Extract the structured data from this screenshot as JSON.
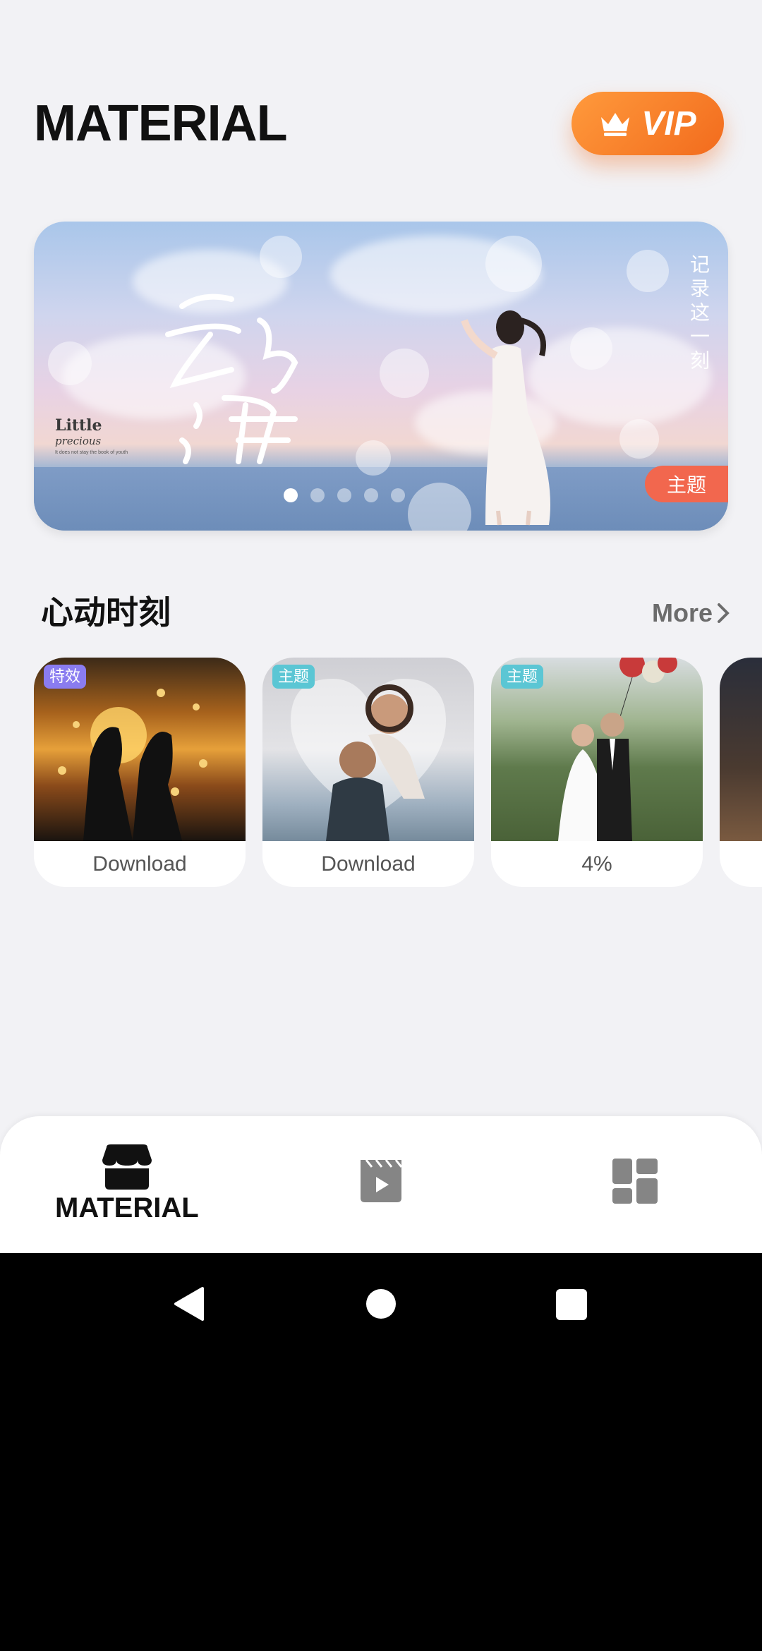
{
  "header": {
    "title": "MATERIAL",
    "vip_label": "VIP",
    "vip_icon": "crown-icon"
  },
  "banner": {
    "calligraphy": "云与海",
    "little_title": "Little",
    "little_sub": "precious",
    "little_small": "It does not stay the book of youth",
    "vertical_text": "记录这一刻",
    "tag": "主题",
    "slide_count": 5,
    "active_slide": 1
  },
  "section": {
    "title": "心动时刻",
    "more_label": "More"
  },
  "cards": [
    {
      "badge": "特效",
      "badge_color": "#8a7cf0",
      "caption": "Download",
      "scene": "sunset-couple"
    },
    {
      "badge": "主题",
      "badge_color": "#5bc6d4",
      "caption": "Download",
      "scene": "piggyback-couple"
    },
    {
      "badge": "主题",
      "badge_color": "#5bc6d4",
      "caption": "4%",
      "scene": "wedding-couple"
    },
    {
      "badge": "",
      "caption": "",
      "scene": "partial"
    }
  ],
  "bottom_nav": {
    "items": [
      {
        "label": "MATERIAL",
        "icon": "store-icon",
        "active": true
      },
      {
        "label": "",
        "icon": "video-clapper-icon",
        "active": false
      },
      {
        "label": "",
        "icon": "grid-icon",
        "active": false
      }
    ]
  },
  "system_nav": {
    "back_icon": "back-triangle-icon",
    "home_icon": "home-circle-icon",
    "recents_icon": "recents-square-icon"
  },
  "colors": {
    "accent": "#f26b1d",
    "background": "#f2f2f5",
    "tag": "#f2674e"
  }
}
